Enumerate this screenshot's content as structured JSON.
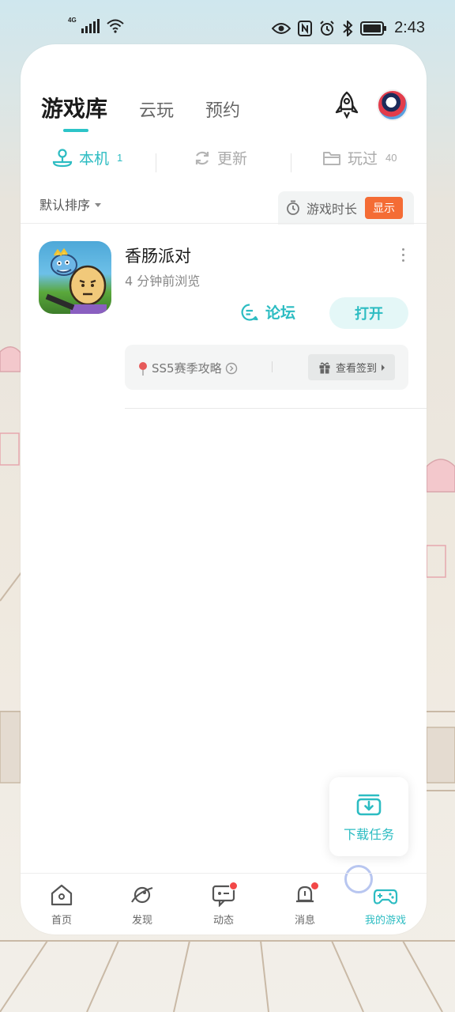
{
  "status_bar": {
    "network": "4G",
    "time": "2:43"
  },
  "header": {
    "tabs": [
      {
        "label": "游戏库",
        "active": true
      },
      {
        "label": "云玩",
        "active": false
      },
      {
        "label": "预约",
        "active": false
      }
    ]
  },
  "sub_tabs": [
    {
      "label": "本机",
      "count": "1",
      "active": true
    },
    {
      "label": "更新",
      "count": "",
      "active": false
    },
    {
      "label": "玩过",
      "count": "40",
      "active": false
    }
  ],
  "sort": {
    "label": "默认排序"
  },
  "playtime": {
    "label": "游戏时长",
    "button": "显示"
  },
  "game": {
    "title": "香肠派对",
    "subtitle": "4 分钟前浏览",
    "forum_label": "论坛",
    "open_label": "打开",
    "guide_label": "SS5赛季攻略",
    "checkin_label": "查看签到"
  },
  "download_task": {
    "label": "下载任务"
  },
  "bottom_nav": [
    {
      "label": "首页",
      "icon": "home-icon",
      "badge": false,
      "active": false
    },
    {
      "label": "发现",
      "icon": "planet-icon",
      "badge": false,
      "active": false
    },
    {
      "label": "动态",
      "icon": "message-icon",
      "badge": true,
      "active": false
    },
    {
      "label": "消息",
      "icon": "bell-icon",
      "badge": true,
      "active": false
    },
    {
      "label": "我的游戏",
      "icon": "gamepad-icon",
      "badge": false,
      "active": true
    }
  ],
  "colors": {
    "accent": "#2cbcc2",
    "badge": "#f24848",
    "show_button": "#f46c35"
  }
}
